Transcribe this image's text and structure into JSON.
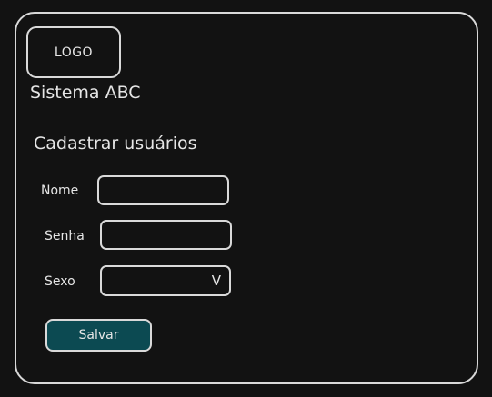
{
  "header": {
    "logo_text": "LOGO",
    "app_title": "Sistema ABC"
  },
  "form": {
    "title": "Cadastrar usuários",
    "fields": {
      "nome": {
        "label": "Nome",
        "value": ""
      },
      "senha": {
        "label": "Senha",
        "value": ""
      },
      "sexo": {
        "label": "Sexo",
        "selected": "",
        "arrow_glyph": "V"
      }
    },
    "save_label": "Salvar"
  },
  "colors": {
    "background": "#121212",
    "stroke": "#d9d9d9",
    "text": "#e6e6e6",
    "button_fill": "#0c4a52"
  }
}
